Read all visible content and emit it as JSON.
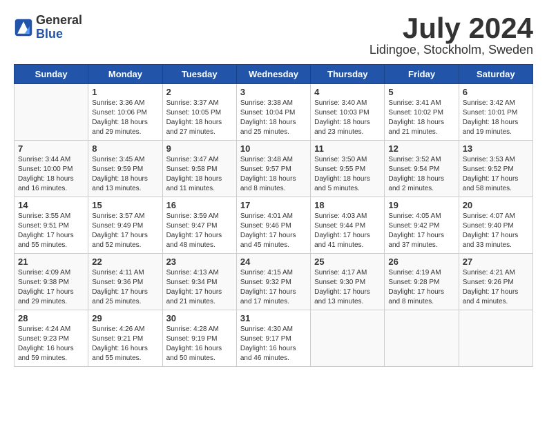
{
  "header": {
    "logo_general": "General",
    "logo_blue": "Blue",
    "month_year": "July 2024",
    "location": "Lidingoe, Stockholm, Sweden"
  },
  "days_of_week": [
    "Sunday",
    "Monday",
    "Tuesday",
    "Wednesday",
    "Thursday",
    "Friday",
    "Saturday"
  ],
  "weeks": [
    [
      {
        "day": "",
        "info": ""
      },
      {
        "day": "1",
        "info": "Sunrise: 3:36 AM\nSunset: 10:06 PM\nDaylight: 18 hours\nand 29 minutes."
      },
      {
        "day": "2",
        "info": "Sunrise: 3:37 AM\nSunset: 10:05 PM\nDaylight: 18 hours\nand 27 minutes."
      },
      {
        "day": "3",
        "info": "Sunrise: 3:38 AM\nSunset: 10:04 PM\nDaylight: 18 hours\nand 25 minutes."
      },
      {
        "day": "4",
        "info": "Sunrise: 3:40 AM\nSunset: 10:03 PM\nDaylight: 18 hours\nand 23 minutes."
      },
      {
        "day": "5",
        "info": "Sunrise: 3:41 AM\nSunset: 10:02 PM\nDaylight: 18 hours\nand 21 minutes."
      },
      {
        "day": "6",
        "info": "Sunrise: 3:42 AM\nSunset: 10:01 PM\nDaylight: 18 hours\nand 19 minutes."
      }
    ],
    [
      {
        "day": "7",
        "info": "Sunrise: 3:44 AM\nSunset: 10:00 PM\nDaylight: 18 hours\nand 16 minutes."
      },
      {
        "day": "8",
        "info": "Sunrise: 3:45 AM\nSunset: 9:59 PM\nDaylight: 18 hours\nand 13 minutes."
      },
      {
        "day": "9",
        "info": "Sunrise: 3:47 AM\nSunset: 9:58 PM\nDaylight: 18 hours\nand 11 minutes."
      },
      {
        "day": "10",
        "info": "Sunrise: 3:48 AM\nSunset: 9:57 PM\nDaylight: 18 hours\nand 8 minutes."
      },
      {
        "day": "11",
        "info": "Sunrise: 3:50 AM\nSunset: 9:55 PM\nDaylight: 18 hours\nand 5 minutes."
      },
      {
        "day": "12",
        "info": "Sunrise: 3:52 AM\nSunset: 9:54 PM\nDaylight: 18 hours\nand 2 minutes."
      },
      {
        "day": "13",
        "info": "Sunrise: 3:53 AM\nSunset: 9:52 PM\nDaylight: 17 hours\nand 58 minutes."
      }
    ],
    [
      {
        "day": "14",
        "info": "Sunrise: 3:55 AM\nSunset: 9:51 PM\nDaylight: 17 hours\nand 55 minutes."
      },
      {
        "day": "15",
        "info": "Sunrise: 3:57 AM\nSunset: 9:49 PM\nDaylight: 17 hours\nand 52 minutes."
      },
      {
        "day": "16",
        "info": "Sunrise: 3:59 AM\nSunset: 9:47 PM\nDaylight: 17 hours\nand 48 minutes."
      },
      {
        "day": "17",
        "info": "Sunrise: 4:01 AM\nSunset: 9:46 PM\nDaylight: 17 hours\nand 45 minutes."
      },
      {
        "day": "18",
        "info": "Sunrise: 4:03 AM\nSunset: 9:44 PM\nDaylight: 17 hours\nand 41 minutes."
      },
      {
        "day": "19",
        "info": "Sunrise: 4:05 AM\nSunset: 9:42 PM\nDaylight: 17 hours\nand 37 minutes."
      },
      {
        "day": "20",
        "info": "Sunrise: 4:07 AM\nSunset: 9:40 PM\nDaylight: 17 hours\nand 33 minutes."
      }
    ],
    [
      {
        "day": "21",
        "info": "Sunrise: 4:09 AM\nSunset: 9:38 PM\nDaylight: 17 hours\nand 29 minutes."
      },
      {
        "day": "22",
        "info": "Sunrise: 4:11 AM\nSunset: 9:36 PM\nDaylight: 17 hours\nand 25 minutes."
      },
      {
        "day": "23",
        "info": "Sunrise: 4:13 AM\nSunset: 9:34 PM\nDaylight: 17 hours\nand 21 minutes."
      },
      {
        "day": "24",
        "info": "Sunrise: 4:15 AM\nSunset: 9:32 PM\nDaylight: 17 hours\nand 17 minutes."
      },
      {
        "day": "25",
        "info": "Sunrise: 4:17 AM\nSunset: 9:30 PM\nDaylight: 17 hours\nand 13 minutes."
      },
      {
        "day": "26",
        "info": "Sunrise: 4:19 AM\nSunset: 9:28 PM\nDaylight: 17 hours\nand 8 minutes."
      },
      {
        "day": "27",
        "info": "Sunrise: 4:21 AM\nSunset: 9:26 PM\nDaylight: 17 hours\nand 4 minutes."
      }
    ],
    [
      {
        "day": "28",
        "info": "Sunrise: 4:24 AM\nSunset: 9:23 PM\nDaylight: 16 hours\nand 59 minutes."
      },
      {
        "day": "29",
        "info": "Sunrise: 4:26 AM\nSunset: 9:21 PM\nDaylight: 16 hours\nand 55 minutes."
      },
      {
        "day": "30",
        "info": "Sunrise: 4:28 AM\nSunset: 9:19 PM\nDaylight: 16 hours\nand 50 minutes."
      },
      {
        "day": "31",
        "info": "Sunrise: 4:30 AM\nSunset: 9:17 PM\nDaylight: 16 hours\nand 46 minutes."
      },
      {
        "day": "",
        "info": ""
      },
      {
        "day": "",
        "info": ""
      },
      {
        "day": "",
        "info": ""
      }
    ]
  ]
}
